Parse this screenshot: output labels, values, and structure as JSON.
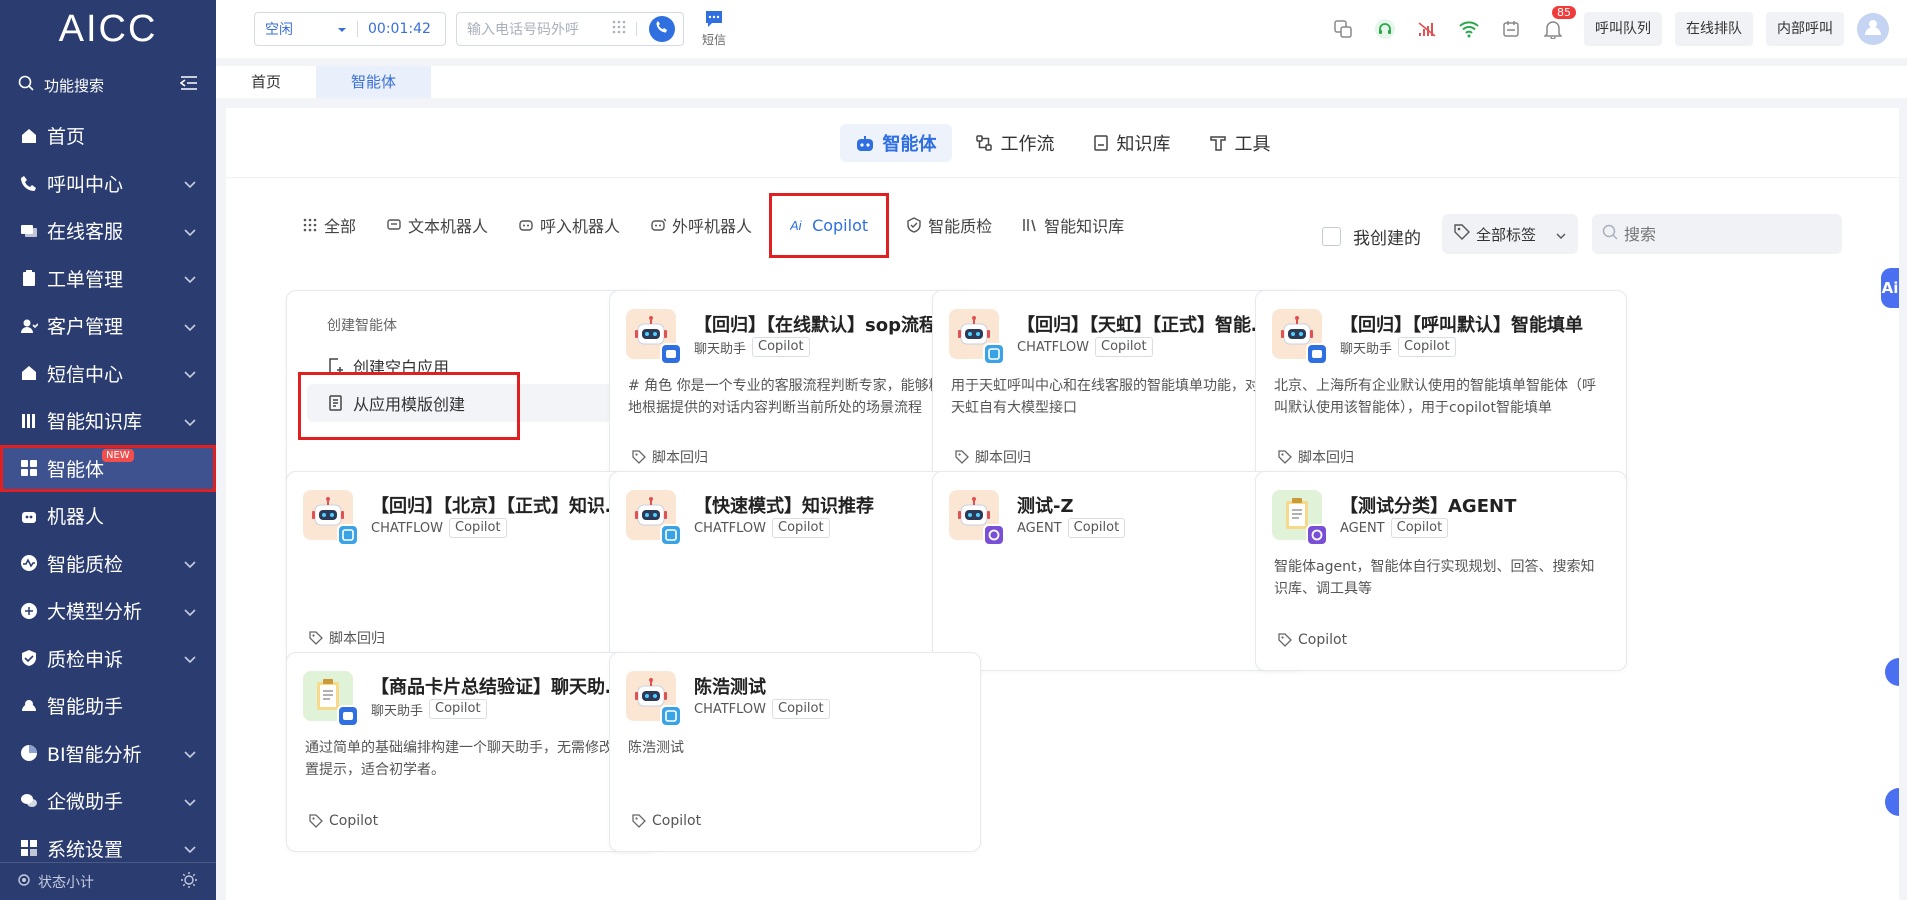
{
  "app": {
    "logo": "AICC"
  },
  "sidebar": {
    "search_label": "功能搜索",
    "items": [
      {
        "label": "首页",
        "icon": "home-icon",
        "expand": false
      },
      {
        "label": "呼叫中心",
        "icon": "phone-icon",
        "expand": true
      },
      {
        "label": "在线客服",
        "icon": "chat-icon",
        "expand": true
      },
      {
        "label": "工单管理",
        "icon": "clipboard-icon",
        "expand": true
      },
      {
        "label": "客户管理",
        "icon": "users-icon",
        "expand": true
      },
      {
        "label": "短信中心",
        "icon": "mail-icon",
        "expand": true
      },
      {
        "label": "智能知识库",
        "icon": "library-icon",
        "expand": true
      },
      {
        "label": "智能体",
        "icon": "grid-icon",
        "expand": false,
        "active": true,
        "badge": "NEW"
      },
      {
        "label": "机器人",
        "icon": "robot-icon",
        "expand": false
      },
      {
        "label": "智能质检",
        "icon": "pulse-icon",
        "expand": true
      },
      {
        "label": "大模型分析",
        "icon": "brain-icon",
        "expand": true
      },
      {
        "label": "质检申诉",
        "icon": "shield-icon",
        "expand": true
      },
      {
        "label": "智能助手",
        "icon": "assistant-icon",
        "expand": false
      },
      {
        "label": "BI智能分析",
        "icon": "chart-icon",
        "expand": true
      },
      {
        "label": "企微助手",
        "icon": "wechat-icon",
        "expand": true
      },
      {
        "label": "系统设置",
        "icon": "settings-icon",
        "expand": true
      }
    ],
    "footer_label": "状态小计"
  },
  "topbar": {
    "status": "空闲",
    "timer": "00:01:42",
    "dial_placeholder": "输入电话号码外呼",
    "sms_label": "短信",
    "notification_count": "85",
    "buttons": [
      "呼叫队列",
      "在线排队",
      "内部呼叫"
    ]
  },
  "page_tabs": [
    {
      "label": "首页",
      "active": false
    },
    {
      "label": "智能体",
      "active": true
    }
  ],
  "top_tabs": [
    {
      "label": "智能体",
      "icon": "robot-icon",
      "active": true
    },
    {
      "label": "工作流",
      "icon": "workflow-icon",
      "active": false
    },
    {
      "label": "知识库",
      "icon": "book-icon",
      "active": false
    },
    {
      "label": "工具",
      "icon": "tool-icon",
      "active": false
    }
  ],
  "categories": [
    {
      "label": "全部",
      "icon": "dots-grid-icon",
      "active": false
    },
    {
      "label": "文本机器人",
      "icon": "text-robot-icon",
      "active": false
    },
    {
      "label": "呼入机器人",
      "icon": "inbound-robot-icon",
      "active": false
    },
    {
      "label": "外呼机器人",
      "icon": "outbound-robot-icon",
      "active": false
    },
    {
      "label": "Copilot",
      "icon": "ai-icon",
      "active": true
    },
    {
      "label": "智能质检",
      "icon": "shield-check-icon",
      "active": false
    },
    {
      "label": "智能知识库",
      "icon": "library-icon",
      "active": false
    }
  ],
  "filters": {
    "mine_label": "我创建的",
    "tag_label": "全部标签",
    "search_placeholder": "搜索"
  },
  "create_card": {
    "title": "创建智能体",
    "blank_label": "创建空白应用",
    "template_label": "从应用模版创建"
  },
  "agents": [
    {
      "name": "【回归】【在线默认】sop流程判断",
      "type": "聊天助手",
      "tag": "Copilot",
      "desc": "# 角色 你是一个专业的客服流程判断专家，能够精准地根据提供的对话内容判断当前所处的场景流程",
      "label": "脚本回归",
      "icon": "robot-icon",
      "sub": "chat-sub-icon",
      "color": "#2f6fe0"
    },
    {
      "name": "【回归】【天虹】【正式】智能填单",
      "type": "CHATFLOW",
      "tag": "Copilot",
      "desc": "用于天虹呼叫中心和在线客服的智能填单功能，对接天虹自有大模型接口",
      "label": "脚本回归",
      "icon": "robot-icon",
      "sub": "flow-sub-icon",
      "color": "#3aa3e6"
    },
    {
      "name": "【回归】【呼叫默认】智能填单",
      "type": "聊天助手",
      "tag": "Copilot",
      "desc": "北京、上海所有企业默认使用的智能填单智能体（呼叫默认使用该智能体），用于copilot智能填单",
      "label": "脚本回归",
      "icon": "robot-icon",
      "sub": "chat-sub-icon",
      "color": "#2f6fe0"
    },
    {
      "name": "【回归】【北京】【正式】知识推荐",
      "type": "CHATFLOW",
      "tag": "Copilot",
      "desc": "",
      "label": "脚本回归",
      "icon": "robot-icon",
      "sub": "flow-sub-icon",
      "color": "#3aa3e6"
    },
    {
      "name": "【快速模式】知识推荐",
      "type": "CHATFLOW",
      "tag": "Copilot",
      "desc": "",
      "label": "",
      "icon": "robot-icon",
      "sub": "flow-sub-icon",
      "color": "#3aa3e6"
    },
    {
      "name": "测试-Z",
      "type": "AGENT",
      "tag": "Copilot",
      "desc": "",
      "label": "",
      "icon": "robot-icon",
      "sub": "agent-sub-icon",
      "color": "#7a4fd8"
    },
    {
      "name": "【测试分类】AGENT",
      "type": "AGENT",
      "tag": "Copilot",
      "desc": "智能体agent，智能体自行实现规划、回答、搜索知识库、调工具等",
      "label": "Copilot",
      "icon": "clipboard-icon",
      "sub": "agent-sub-icon",
      "color": "#7a4fd8"
    },
    {
      "name": "【商品卡片总结验证】聊天助手-测试",
      "type": "聊天助手",
      "tag": "Copilot",
      "desc": "通过简单的基础编排构建一个聊天助手，无需修改内置提示，适合初学者。",
      "label": "Copilot",
      "icon": "clipboard-icon",
      "sub": "chat-sub-icon",
      "color": "#2f6fe0"
    },
    {
      "name": "陈浩测试",
      "type": "CHATFLOW",
      "tag": "Copilot",
      "desc": "陈浩测试",
      "label": "Copilot",
      "icon": "robot-icon",
      "sub": "flow-sub-icon",
      "color": "#3aa3e6"
    }
  ],
  "edge": {
    "ai_label": "Ai"
  }
}
